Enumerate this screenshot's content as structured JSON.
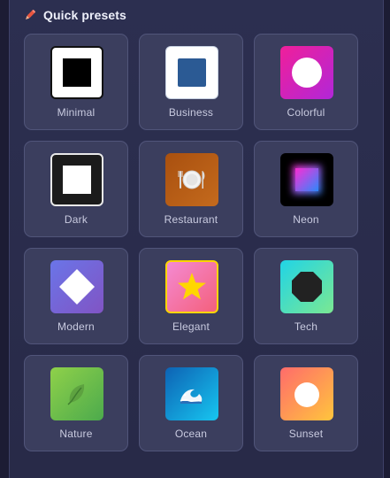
{
  "header": {
    "icon": "pencil-icon",
    "title": "Quick presets"
  },
  "presets": [
    {
      "label": "Minimal",
      "icon": "black-square-icon"
    },
    {
      "label": "Business",
      "icon": "blue-square-icon"
    },
    {
      "label": "Colorful",
      "icon": "white-circle-icon"
    },
    {
      "label": "Dark",
      "icon": "white-square-icon"
    },
    {
      "label": "Restaurant",
      "icon": "plate-cutlery-icon"
    },
    {
      "label": "Neon",
      "icon": "glowing-square-icon"
    },
    {
      "label": "Modern",
      "icon": "diamond-icon"
    },
    {
      "label": "Elegant",
      "icon": "star-icon"
    },
    {
      "label": "Tech",
      "icon": "octagon-icon"
    },
    {
      "label": "Nature",
      "icon": "leaf-icon"
    },
    {
      "label": "Ocean",
      "icon": "wave-icon"
    },
    {
      "label": "Sunset",
      "icon": "sun-circle-icon"
    }
  ],
  "colors": {
    "pencil": "#e8553f",
    "star": "#ffd600",
    "business_square": "#2b5a94",
    "colorful_gradient": [
      "#f01f9a",
      "#b127d8"
    ],
    "modern_gradient": [
      "#6a75e8",
      "#8154c4"
    ],
    "elegant_gradient": [
      "#f48ad2",
      "#f4607c"
    ],
    "tech_gradient": [
      "#20d4e6",
      "#7be892"
    ],
    "nature_gradient": [
      "#8fd14a",
      "#4caa4c"
    ],
    "ocean_gradient": [
      "#0d62b4",
      "#17c6f0"
    ],
    "sunset_gradient": [
      "#ff6b6b",
      "#ffc53d"
    ],
    "restaurant_gradient": [
      "#a9500f",
      "#c46a1d"
    ]
  }
}
